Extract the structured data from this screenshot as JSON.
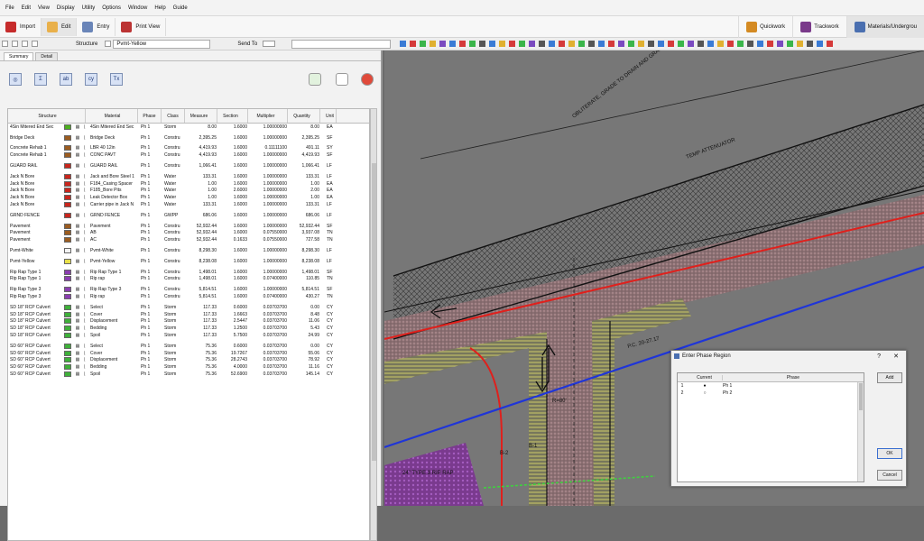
{
  "menu": [
    "File",
    "Edit",
    "View",
    "Display",
    "Utility",
    "Options",
    "Window",
    "Help",
    "Guide"
  ],
  "toolbar": {
    "import": "Import",
    "edit": "Edit",
    "entry": "Entry",
    "print_view": "Print View",
    "right_tabs": [
      "Quickwork",
      "Trackwork",
      "Materials/Undergrou"
    ]
  },
  "toolbar2": {
    "structure_label": "Structure",
    "structure_value": "Pvmt-Yellow",
    "send_to_label": "Send To"
  },
  "panel": {
    "tabs": [
      "Summary",
      "Detail"
    ]
  },
  "grid": {
    "headers": [
      "Structure",
      "Material",
      "Phase",
      "Class",
      "Measure",
      "Section",
      "Multiplier",
      "Quantity",
      "Unit"
    ],
    "rows": [
      {
        "s": "4Sin Mitered End Sec",
        "c": "#4caf1f",
        "m": "4Sin Mitered End Sec",
        "p": "Ph 1",
        "k": "Storm",
        "me": "8.00",
        "se": "1.6000",
        "mu": "1.00000000",
        "q": "8.00",
        "u": "EA"
      },
      {
        "spacer": true
      },
      {
        "s": "Bridge Deck",
        "c": "#9b5c20",
        "m": "Bridge Deck",
        "p": "Ph 1",
        "k": "Constru",
        "me": "2,395.25",
        "se": "1.6000",
        "mu": "1.00000000",
        "q": "2,395.25",
        "u": "SF"
      },
      {
        "spacer": true
      },
      {
        "s": "Concrete Rehab 1",
        "c": "#9b5c20",
        "m": "LBR 40 12in",
        "p": "Ph 1",
        "k": "Constru",
        "me": "4,419.93",
        "se": "1.6000",
        "mu": "0.11111100",
        "q": "491.11",
        "u": "SY"
      },
      {
        "s": "Concrete Rehab 1",
        "c": "#9b5c20",
        "m": "CONC PAVT",
        "p": "Ph 1",
        "k": "Constru",
        "me": "4,419.93",
        "se": "1.6000",
        "mu": "1.00000000",
        "q": "4,419.93",
        "u": "SF"
      },
      {
        "spacer": true
      },
      {
        "s": "GUARD RAIL",
        "c": "#c8261d",
        "m": "GUARD RAIL",
        "p": "Ph 1",
        "k": "Constru",
        "me": "1,066.41",
        "se": "1.6000",
        "mu": "1.00000000",
        "q": "1,066.41",
        "u": "LF"
      },
      {
        "spacer": true
      },
      {
        "s": "Jack N Bore",
        "c": "#c8261d",
        "m": "Jack and Bore Steel 1",
        "p": "Ph 1",
        "k": "Water",
        "me": "133.31",
        "se": "1.6000",
        "mu": "1.00000000",
        "q": "133.31",
        "u": "LF"
      },
      {
        "s": "Jack N Bore",
        "c": "#c8261d",
        "m": "F184_Casing Spacer",
        "p": "Ph 1",
        "k": "Water",
        "me": "1.00",
        "se": "1.6000",
        "mu": "1.00000000",
        "q": "1.00",
        "u": "EA"
      },
      {
        "s": "Jack N Bore",
        "c": "#c8261d",
        "m": "F185_Bore Pits",
        "p": "Ph 1",
        "k": "Water",
        "me": "1.00",
        "se": "2.6000",
        "mu": "1.00000000",
        "q": "2.00",
        "u": "EA"
      },
      {
        "s": "Jack N Bore",
        "c": "#c8261d",
        "m": "Leak Detector Box",
        "p": "Ph 1",
        "k": "Water",
        "me": "1.00",
        "se": "1.6000",
        "mu": "1.00000000",
        "q": "1.00",
        "u": "EA"
      },
      {
        "s": "Jack N Bore",
        "c": "#c8261d",
        "m": "Carrier pipe in Jack N",
        "p": "Ph 1",
        "k": "Water",
        "me": "133.31",
        "se": "1.6000",
        "mu": "1.00000000",
        "q": "133.31",
        "u": "LF"
      },
      {
        "spacer": true
      },
      {
        "s": "GRND FENCE",
        "c": "#c8261d",
        "m": "GRND FENCE",
        "p": "Ph 1",
        "k": "GWPP",
        "me": "686.06",
        "se": "1.6000",
        "mu": "1.00000000",
        "q": "686.06",
        "u": "LF"
      },
      {
        "spacer": true
      },
      {
        "s": "Pavement",
        "c": "#9b5c20",
        "m": "Pavement",
        "p": "Ph 1",
        "k": "Constru",
        "me": "52,932.44",
        "se": "1.6000",
        "mu": "1.00000000",
        "q": "52,932.44",
        "u": "SF"
      },
      {
        "s": "Pavement",
        "c": "#9b5c20",
        "m": "AB",
        "p": "Ph 1",
        "k": "Constru",
        "me": "52,932.44",
        "se": "1.6000",
        "mu": "0.07550000",
        "q": "3,937.08",
        "u": "TN"
      },
      {
        "s": "Pavement",
        "c": "#9b5c20",
        "m": "AC",
        "p": "Ph 1",
        "k": "Constru",
        "me": "52,932.44",
        "se": "0.1633",
        "mu": "0.07550000",
        "q": "727.58",
        "u": "TN"
      },
      {
        "spacer": true
      },
      {
        "s": "Pvmt-White",
        "c": "#f4f4f4",
        "m": "Pvmt-White",
        "p": "Ph 1",
        "k": "Constru",
        "me": "8,298.30",
        "se": "1.6000",
        "mu": "1.00000000",
        "q": "8,298.30",
        "u": "LF"
      },
      {
        "spacer": true
      },
      {
        "s": "Pvmt-Yellow",
        "c": "#e8e04a",
        "m": "Pvmt-Yellow",
        "p": "Ph 1",
        "k": "Constru",
        "me": "8,238.08",
        "se": "1.6000",
        "mu": "1.00000000",
        "q": "8,238.08",
        "u": "LF"
      },
      {
        "spacer": true
      },
      {
        "s": "Rip Rap Type 1",
        "c": "#8b3fb0",
        "m": "Rip Rap Type 1",
        "p": "Ph 1",
        "k": "Constru",
        "me": "1,498.01",
        "se": "1.6000",
        "mu": "1.00000000",
        "q": "1,498.01",
        "u": "SF"
      },
      {
        "s": "Rip Rap Type 1",
        "c": "#8b3fb0",
        "m": "Rip rap",
        "p": "Ph 1",
        "k": "Constru",
        "me": "1,498.01",
        "se": "1.6000",
        "mu": "0.07400000",
        "q": "110.85",
        "u": "TN"
      },
      {
        "spacer": true
      },
      {
        "s": "Rip Rap Type 3",
        "c": "#8b3fb0",
        "m": "Rip Rap Type 3",
        "p": "Ph 1",
        "k": "Constru",
        "me": "5,814.51",
        "se": "1.6000",
        "mu": "1.00000000",
        "q": "5,814.51",
        "u": "SF"
      },
      {
        "s": "Rip Rap Type 3",
        "c": "#8b3fb0",
        "m": "Rip rap",
        "p": "Ph 1",
        "k": "Constru",
        "me": "5,814.51",
        "se": "1.6000",
        "mu": "0.07400000",
        "q": "430.27",
        "u": "TN"
      },
      {
        "spacer": true
      },
      {
        "s": "SD 18\" RCP Culvert",
        "c": "#3fb03a",
        "m": "Select",
        "p": "Ph 1",
        "k": "Storm",
        "me": "117.33",
        "se": "0.6000",
        "mu": "0.03703700",
        "q": "0.00",
        "u": "CY"
      },
      {
        "s": "SD 18\" RCP Culvert",
        "c": "#3fb03a",
        "m": "Cover",
        "p": "Ph 1",
        "k": "Storm",
        "me": "117.33",
        "se": "1.6663",
        "mu": "0.03703700",
        "q": "8.48",
        "u": "CY"
      },
      {
        "s": "SD 18\" RCP Culvert",
        "c": "#3fb03a",
        "m": "Displacement",
        "p": "Ph 1",
        "k": "Storm",
        "me": "117.33",
        "se": "2.5447",
        "mu": "0.03703700",
        "q": "11.06",
        "u": "CY"
      },
      {
        "s": "SD 18\" RCP Culvert",
        "c": "#3fb03a",
        "m": "Bedding",
        "p": "Ph 1",
        "k": "Storm",
        "me": "117.33",
        "se": "1.2500",
        "mu": "0.03703700",
        "q": "5.43",
        "u": "CY"
      },
      {
        "s": "SD 18\" RCP Culvert",
        "c": "#3fb03a",
        "m": "Spoil",
        "p": "Ph 1",
        "k": "Storm",
        "me": "117.33",
        "se": "5.7500",
        "mu": "0.03703700",
        "q": "24.99",
        "u": "CY"
      },
      {
        "spacer": true
      },
      {
        "s": "SD 60\" RCP Culvert",
        "c": "#3fb03a",
        "m": "Select",
        "p": "Ph 1",
        "k": "Storm",
        "me": "75.36",
        "se": "0.6000",
        "mu": "0.03703700",
        "q": "0.00",
        "u": "CY"
      },
      {
        "s": "SD 60\" RCP Culvert",
        "c": "#3fb03a",
        "m": "Cover",
        "p": "Ph 1",
        "k": "Storm",
        "me": "75.36",
        "se": "19.7267",
        "mu": "0.03703700",
        "q": "55.06",
        "u": "CY"
      },
      {
        "s": "SD 60\" RCP Culvert",
        "c": "#3fb03a",
        "m": "Displacement",
        "p": "Ph 1",
        "k": "Storm",
        "me": "75.36",
        "se": "28.2743",
        "mu": "0.03703700",
        "q": "78.92",
        "u": "CY"
      },
      {
        "s": "SD 60\" RCP Culvert",
        "c": "#3fb03a",
        "m": "Bedding",
        "p": "Ph 1",
        "k": "Storm",
        "me": "75.36",
        "se": "4.0000",
        "mu": "0.03703700",
        "q": "11.16",
        "u": "CY"
      },
      {
        "s": "SD 60\" RCP Culvert",
        "c": "#3fb03a",
        "m": "Spoil",
        "p": "Ph 1",
        "k": "Storm",
        "me": "75.36",
        "se": "52.6900",
        "mu": "0.03703700",
        "q": "145.14",
        "u": "CY"
      }
    ]
  },
  "cad_labels": {
    "obliterate": "OBLITERATE, GRADE TO DRAIN AND GRASS",
    "attenuator": "TEMP ATTENUATOR",
    "pc": "P.C. 20-27.17",
    "riprap": "24\" TYPE 3 RIP RAP",
    "b1": "B-1",
    "b2": "B-2",
    "r80": "R=80'"
  },
  "dialog": {
    "title": "Enter Phase Region",
    "help": "?",
    "close": "✕",
    "col_current": "Current",
    "col_phase": "Phase",
    "rows": [
      {
        "num": "1",
        "current": "●",
        "phase": "Ph 1"
      },
      {
        "num": "2",
        "current": "○",
        "phase": "Ph 2"
      }
    ],
    "add": "Add",
    "ok": "OK",
    "cancel": "Cancel"
  }
}
